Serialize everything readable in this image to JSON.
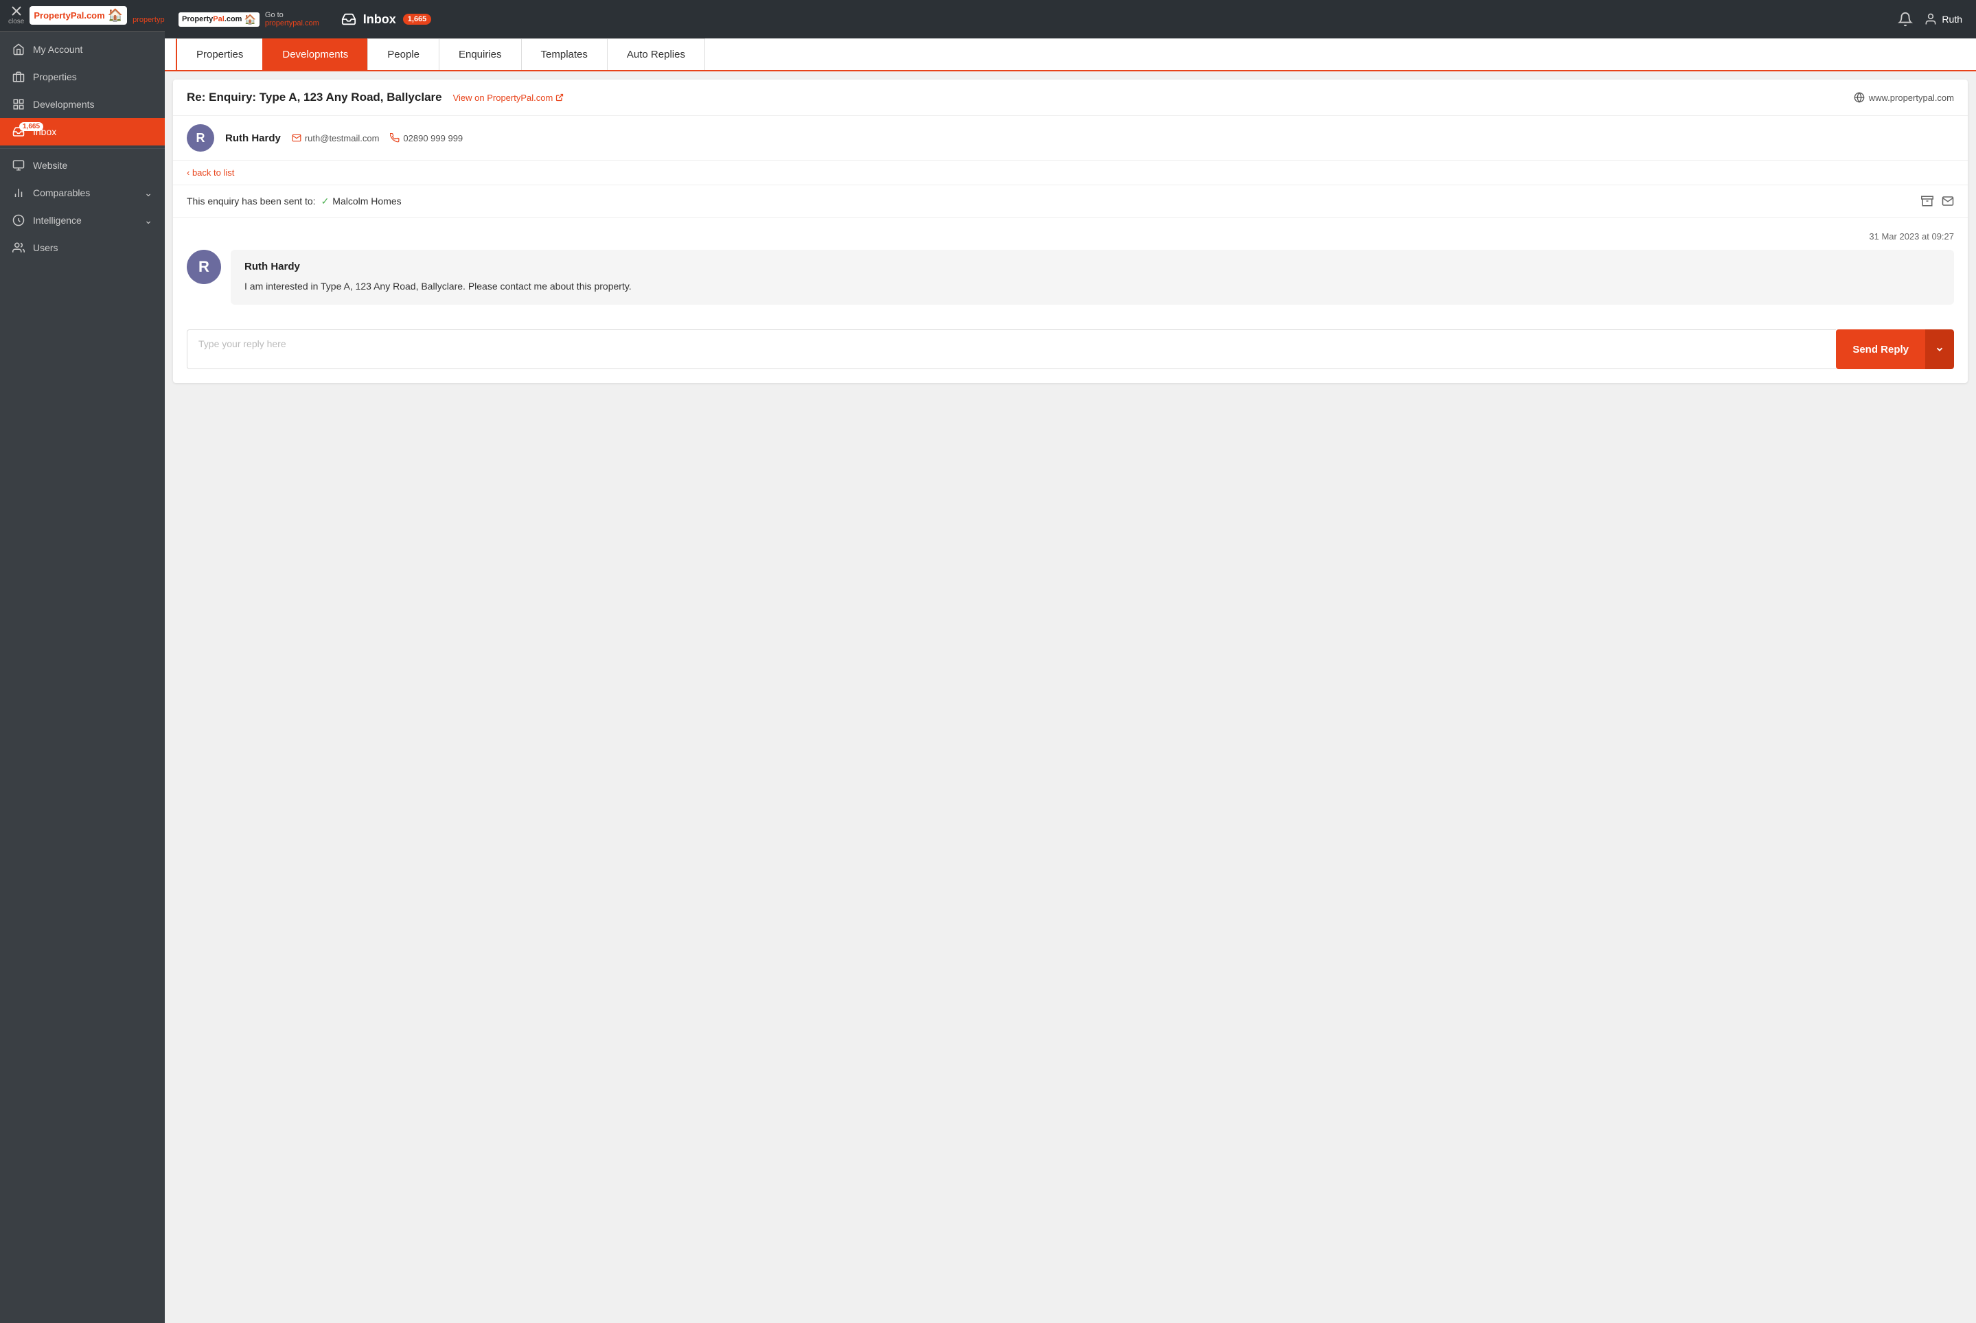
{
  "sidebar": {
    "close_label": "close",
    "logo_text1": "Property",
    "logo_text2": "Pal",
    "logo_dot": ".com",
    "goto_label": "Go to",
    "goto_link": "propertypal.com",
    "nav_items": [
      {
        "id": "my-account",
        "label": "My Account",
        "icon": "home",
        "active": false,
        "badge": null
      },
      {
        "id": "properties",
        "label": "Properties",
        "icon": "building",
        "active": false,
        "badge": null
      },
      {
        "id": "developments",
        "label": "Developments",
        "icon": "grid",
        "active": false,
        "badge": null
      },
      {
        "id": "inbox",
        "label": "Inbox",
        "icon": "inbox",
        "active": true,
        "badge": "1,665"
      },
      {
        "id": "website",
        "label": "Website",
        "icon": "monitor",
        "active": false,
        "badge": null
      },
      {
        "id": "comparables",
        "label": "Comparables",
        "icon": "chart",
        "active": false,
        "badge": null,
        "has_chevron": true
      },
      {
        "id": "intelligence",
        "label": "Intelligence",
        "icon": "analytics",
        "active": false,
        "badge": null,
        "has_chevron": true
      },
      {
        "id": "users",
        "label": "Users",
        "icon": "users",
        "active": false,
        "badge": null
      }
    ]
  },
  "topbar": {
    "goto_label": "Go to",
    "goto_link": "propertypal.com",
    "inbox_label": "Inbox",
    "inbox_badge": "1,665",
    "user_name": "Ruth",
    "notification_icon": "bell-icon",
    "user_icon": "user-circle-icon"
  },
  "tabs": [
    {
      "id": "properties",
      "label": "Properties",
      "active": false
    },
    {
      "id": "developments",
      "label": "Developments",
      "active": true
    },
    {
      "id": "people",
      "label": "People",
      "active": false
    },
    {
      "id": "enquiries",
      "label": "Enquiries",
      "active": false
    },
    {
      "id": "templates",
      "label": "Templates",
      "active": false
    },
    {
      "id": "auto-replies",
      "label": "Auto Replies",
      "active": false
    }
  ],
  "email": {
    "subject": "Re: Enquiry: Type A, 123 Any Road, Ballyclare",
    "view_link_label": "View on PropertyPal.com",
    "website": "www.propertypal.com",
    "sender": {
      "initial": "R",
      "name": "Ruth Hardy",
      "email": "ruth@testmail.com",
      "phone": "02890 999 999"
    },
    "back_link": "back to list",
    "enquiry_sent_label": "This enquiry has been sent to:",
    "enquiry_company": "Malcolm Homes",
    "timestamp": "31 Mar 2023 at 09:27",
    "message_sender": "Ruth Hardy",
    "message_initial": "R",
    "message_body": "I am interested in Type A, 123 Any Road, Ballyclare. Please contact me about this property.",
    "reply_placeholder": "Type your reply here",
    "send_reply_label": "Send Reply"
  }
}
